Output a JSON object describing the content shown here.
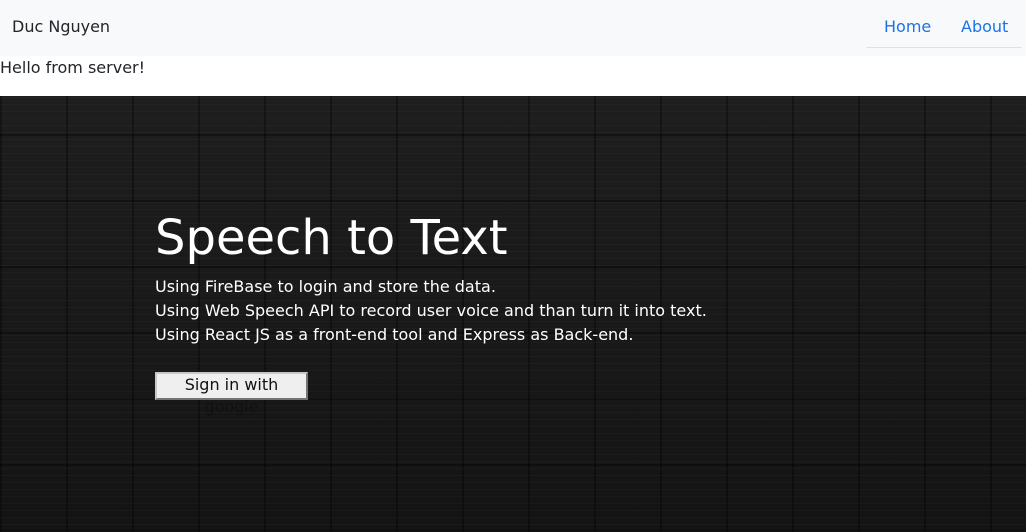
{
  "navbar": {
    "brand": "Duc Nguyen",
    "links": [
      {
        "label": "Home"
      },
      {
        "label": "About"
      }
    ],
    "link_color": "#1a73e8"
  },
  "server_message": "Hello from server!",
  "hero": {
    "title": "Speech to Text",
    "lines": [
      "Using FireBase to login and store the data.",
      "Using Web Speech API to record user voice and than turn it into text.",
      "Using React JS as a front-end tool and Express as Back-end."
    ],
    "signin_label": "Sign in with google"
  }
}
